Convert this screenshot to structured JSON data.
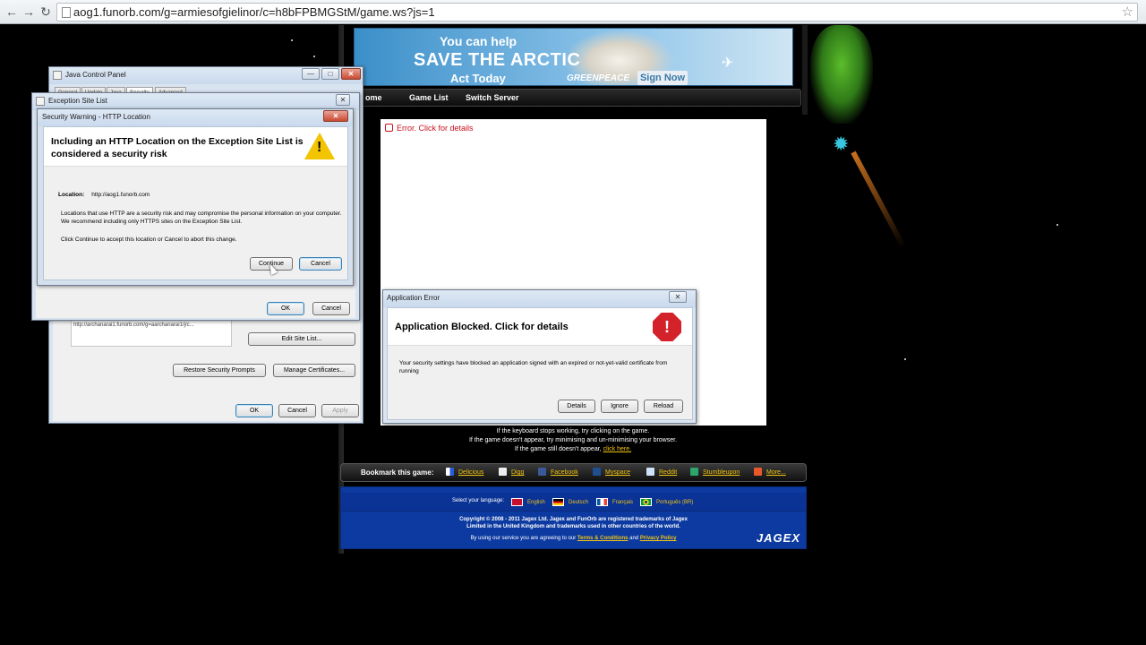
{
  "browser": {
    "url": "aog1.funorb.com/g=armiesofgielinor/c=h8bFPBMGStM/game.ws?js=1",
    "back_glyph": "←",
    "forward_glyph": "→",
    "reload_glyph": "↻",
    "star_glyph": "☆"
  },
  "banner": {
    "line1": "You can help",
    "line2": "SAVE THE ARCTIC",
    "line3": "Act Today",
    "brand": "GREENPEACE",
    "signup": "Sign Now"
  },
  "site_nav": {
    "items": [
      "ome",
      "Game List",
      "Switch Server"
    ]
  },
  "game": {
    "error_text": "Error. Click for details",
    "help_line1": "If the keyboard stops working, try clicking on the game.",
    "help_line2": "If the game doesn't appear, try minimising and un-minimising your browser.",
    "help_line3_prefix": "If the game still doesn't appear,",
    "help_line3_link": "click here."
  },
  "bookmarks": {
    "label": "Bookmark this game:",
    "items": [
      "Delicious",
      "Digg",
      "Facebook",
      "Myspace",
      "Reddit",
      "Stumbleupon",
      "More..."
    ]
  },
  "footer": {
    "language_label": "Select your language:",
    "languages": [
      "English",
      "Deutsch",
      "Français",
      "Português (BR)"
    ],
    "copyright1": "Copyright © 2008 - 2011 Jagex Ltd. Jagex and FunOrb are registered trademarks of Jagex",
    "copyright2": "Limited in the United Kingdom and trademarks used in other countries of the world.",
    "terms_prefix": "By using our service you are agreeing to our",
    "terms_link": "Terms & Conditions",
    "terms_and": "and",
    "privacy_link": "Privacy Policy",
    "logo": "JAGEX"
  },
  "java_control_panel": {
    "title": "Java Control Panel",
    "tabs": [
      "General",
      "Update",
      "Java",
      "Security",
      "Advanced"
    ],
    "site_list_entry": "http://archanarai1.funorb.com/g=aarchanarai1/j/c...",
    "edit_site_list": "Edit Site List...",
    "restore_prompts": "Restore Security Prompts",
    "manage_certs": "Manage Certificates...",
    "ok": "OK",
    "cancel": "Cancel",
    "apply": "Apply"
  },
  "exception_site_list": {
    "title": "Exception Site List",
    "ok": "OK",
    "cancel": "Cancel"
  },
  "security_warning": {
    "title": "Security Warning - HTTP Location",
    "heading": "Including an HTTP Location on the Exception Site List is considered a security risk",
    "location_label": "Location:",
    "location_value": "http://aog1.funorb.com",
    "body1": "Locations that use HTTP are a security risk and may compromise the personal information on your computer.  We recommend including only HTTPS sites on the Exception Site List.",
    "body2": "Click Continue to accept this location or Cancel to abort this change.",
    "continue": "Continue",
    "cancel": "Cancel"
  },
  "application_error": {
    "title": "Application Error",
    "heading": "Application Blocked. Click for details",
    "body": "Your security settings have blocked an application signed with an expired or not-yet-valid certificate from running",
    "details": "Details",
    "ignore": "Ignore",
    "reload": "Reload"
  },
  "colors": {
    "error_red": "#c8101e",
    "link_yellow": "#f1c40f",
    "footer_blue": "#0d3aa1"
  }
}
